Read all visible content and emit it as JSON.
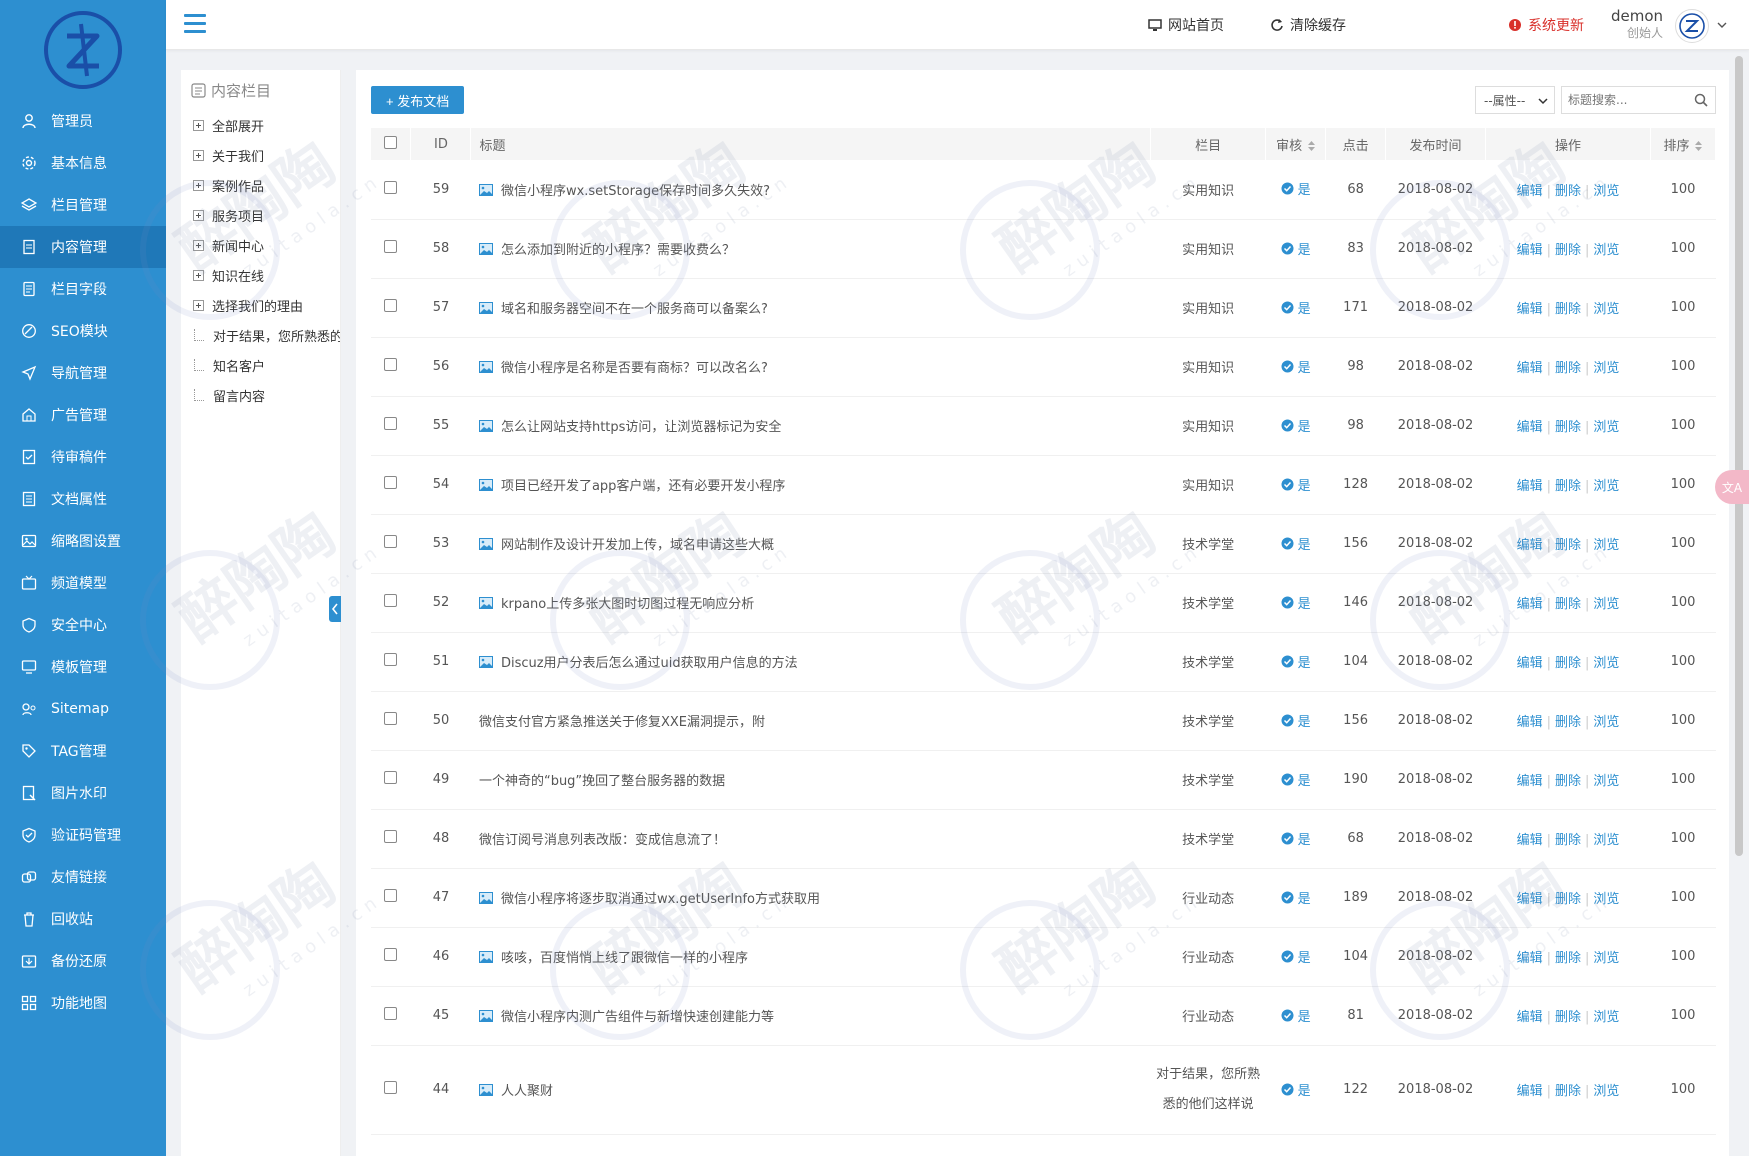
{
  "sidebar": {
    "items": [
      {
        "label": "管理员",
        "icon": "user-icon"
      },
      {
        "label": "基本信息",
        "icon": "gear-icon"
      },
      {
        "label": "栏目管理",
        "icon": "layers-icon"
      },
      {
        "label": "内容管理",
        "icon": "document-icon",
        "active": true
      },
      {
        "label": "栏目字段",
        "icon": "form-icon"
      },
      {
        "label": "SEO模块",
        "icon": "seo-icon"
      },
      {
        "label": "导航管理",
        "icon": "navigation-icon"
      },
      {
        "label": "广告管理",
        "icon": "ad-icon"
      },
      {
        "label": "待审稿件",
        "icon": "pending-icon"
      },
      {
        "label": "文档属性",
        "icon": "attribute-icon"
      },
      {
        "label": "缩略图设置",
        "icon": "image-icon"
      },
      {
        "label": "频道模型",
        "icon": "tv-icon"
      },
      {
        "label": "安全中心",
        "icon": "shield-icon"
      },
      {
        "label": "模板管理",
        "icon": "monitor-icon"
      },
      {
        "label": "Sitemap",
        "icon": "sitemap-icon"
      },
      {
        "label": "TAG管理",
        "icon": "tag-icon"
      },
      {
        "label": "图片水印",
        "icon": "watermark-icon"
      },
      {
        "label": "验证码管理",
        "icon": "captcha-icon"
      },
      {
        "label": "友情链接",
        "icon": "link-icon"
      },
      {
        "label": "回收站",
        "icon": "trash-icon"
      },
      {
        "label": "备份还原",
        "icon": "backup-icon"
      },
      {
        "label": "功能地图",
        "icon": "grid-icon"
      }
    ]
  },
  "header": {
    "home_link": "网站首页",
    "clear_cache": "清除缓存",
    "system_update": "系统更新",
    "user_name": "demon",
    "user_role": "创始人"
  },
  "tree": {
    "title": "内容栏目",
    "items": [
      {
        "label": "全部展开",
        "type": "plus"
      },
      {
        "label": "关于我们",
        "type": "plus"
      },
      {
        "label": "案例作品",
        "type": "plus"
      },
      {
        "label": "服务项目",
        "type": "plus"
      },
      {
        "label": "新闻中心",
        "type": "plus"
      },
      {
        "label": "知识在线",
        "type": "plus"
      },
      {
        "label": "选择我们的理由",
        "type": "plus"
      },
      {
        "label": "对于结果，您所熟悉的",
        "type": "leaf"
      },
      {
        "label": "知名客户",
        "type": "leaf"
      },
      {
        "label": "留言内容",
        "type": "leaf"
      }
    ]
  },
  "toolbar": {
    "publish_label": "+ 发布文档",
    "attr_select": "--属性--",
    "search_placeholder": "标题搜索..."
  },
  "table": {
    "headers": {
      "id": "ID",
      "title": "标题",
      "column": "栏目",
      "audit": "审核",
      "clicks": "点击",
      "date": "发布时间",
      "ops": "操作",
      "sort": "排序"
    },
    "op_labels": {
      "edit": "编辑",
      "delete": "删除",
      "view": "浏览"
    },
    "rows": [
      {
        "id": "59",
        "title": "微信小程序wx.setStorage保存时间多久失效?",
        "img": true,
        "column": "实用知识",
        "audit": "是",
        "clicks": "68",
        "date": "2018-08-02",
        "sort": "100"
      },
      {
        "id": "58",
        "title": "怎么添加到附近的小程序？需要收费么？",
        "img": true,
        "column": "实用知识",
        "audit": "是",
        "clicks": "83",
        "date": "2018-08-02",
        "sort": "100"
      },
      {
        "id": "57",
        "title": "域名和服务器空间不在一个服务商可以备案么?",
        "img": true,
        "column": "实用知识",
        "audit": "是",
        "clicks": "171",
        "date": "2018-08-02",
        "sort": "100"
      },
      {
        "id": "56",
        "title": "微信小程序是名称是否要有商标？可以改名么?",
        "img": true,
        "column": "实用知识",
        "audit": "是",
        "clicks": "98",
        "date": "2018-08-02",
        "sort": "100"
      },
      {
        "id": "55",
        "title": "怎么让网站支持https访问，让浏览器标记为安全",
        "img": true,
        "column": "实用知识",
        "audit": "是",
        "clicks": "98",
        "date": "2018-08-02",
        "sort": "100"
      },
      {
        "id": "54",
        "title": "项目已经开发了app客户端，还有必要开发小程序",
        "img": true,
        "column": "实用知识",
        "audit": "是",
        "clicks": "128",
        "date": "2018-08-02",
        "sort": "100"
      },
      {
        "id": "53",
        "title": "网站制作及设计开发加上传，域名申请这些大概",
        "img": true,
        "column": "技术学堂",
        "audit": "是",
        "clicks": "156",
        "date": "2018-08-02",
        "sort": "100"
      },
      {
        "id": "52",
        "title": "krpano上传多张大图时切图过程无响应分析",
        "img": true,
        "column": "技术学堂",
        "audit": "是",
        "clicks": "146",
        "date": "2018-08-02",
        "sort": "100"
      },
      {
        "id": "51",
        "title": "Discuz用户分表后怎么通过uid获取用户信息的方法",
        "img": true,
        "column": "技术学堂",
        "audit": "是",
        "clicks": "104",
        "date": "2018-08-02",
        "sort": "100"
      },
      {
        "id": "50",
        "title": "微信支付官方紧急推送关于修复XXE漏洞提示，附",
        "img": false,
        "column": "技术学堂",
        "audit": "是",
        "clicks": "156",
        "date": "2018-08-02",
        "sort": "100"
      },
      {
        "id": "49",
        "title": "一个神奇的“bug”挽回了整台服务器的数据",
        "img": false,
        "column": "技术学堂",
        "audit": "是",
        "clicks": "190",
        "date": "2018-08-02",
        "sort": "100"
      },
      {
        "id": "48",
        "title": "微信订阅号消息列表改版：变成信息流了！",
        "img": false,
        "column": "技术学堂",
        "audit": "是",
        "clicks": "68",
        "date": "2018-08-02",
        "sort": "100"
      },
      {
        "id": "47",
        "title": "微信小程序将逐步取消通过wx.getUserInfo方式获取用",
        "img": true,
        "column": "行业动态",
        "audit": "是",
        "clicks": "189",
        "date": "2018-08-02",
        "sort": "100"
      },
      {
        "id": "46",
        "title": "咳咳，百度悄悄上线了跟微信一样的小程序",
        "img": true,
        "column": "行业动态",
        "audit": "是",
        "clicks": "104",
        "date": "2018-08-02",
        "sort": "100"
      },
      {
        "id": "45",
        "title": "微信小程序内测广告组件与新增快速创建能力等",
        "img": true,
        "column": "行业动态",
        "audit": "是",
        "clicks": "81",
        "date": "2018-08-02",
        "sort": "100"
      },
      {
        "id": "44",
        "title": "人人聚财",
        "img": true,
        "column": "对于结果，您所熟悉的他们这样说",
        "column_line1": "对于结果，您所熟",
        "column_line2": "悉的他们这样说",
        "audit": "是",
        "clicks": "122",
        "date": "2018-08-02",
        "sort": "100",
        "tall": true
      }
    ]
  },
  "watermark": {
    "text": "醉陶陶",
    "sub": "zuitaola.cn"
  },
  "colors": {
    "sidebar": "#2d8fd0",
    "sidebar_active": "#1f78b8",
    "accent": "#2d8fd0",
    "danger": "#d9302b"
  }
}
